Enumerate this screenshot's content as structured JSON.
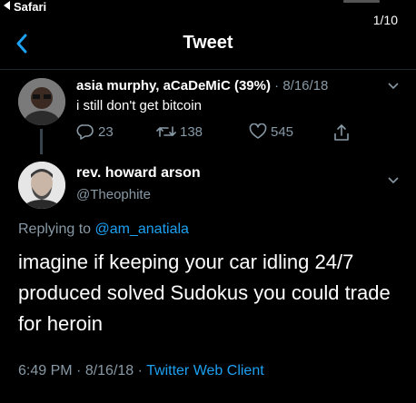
{
  "status_bar": {
    "back_label": "Safari"
  },
  "page_counter": "1/10",
  "nav": {
    "title": "Tweet"
  },
  "parent_tweet": {
    "name": "asia murphy, aCaDeMiC (39%)",
    "separator": " · ",
    "date": "8/16/18",
    "text": "i still don't get bitcoin",
    "replies": "23",
    "retweets": "138",
    "likes": "545"
  },
  "main_tweet": {
    "name": "rev. howard arson",
    "handle": "@Theophite",
    "replying_prefix": "Replying to ",
    "replying_to": "@am_anatiala",
    "text": "imagine if keeping your car idling 24/7 produced solved Sudokus you could trade for heroin",
    "time": "6:49 PM",
    "separator1": " · ",
    "date": "8/16/18",
    "separator2": " · ",
    "client": "Twitter Web Client"
  },
  "colors": {
    "background": "#000000",
    "accent": "#1da1f2",
    "secondary_text": "#8899a6",
    "divider": "#1e2732"
  },
  "icons": [
    "back-chevron-icon",
    "reply-icon",
    "retweet-icon",
    "like-icon",
    "share-icon",
    "chevron-down-icon"
  ]
}
